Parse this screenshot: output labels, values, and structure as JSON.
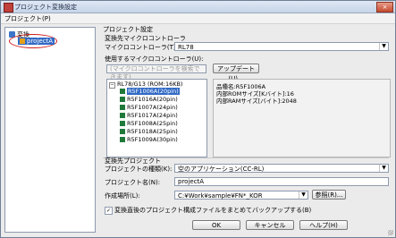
{
  "window": {
    "title": "プロジェクト変換設定",
    "close_glyph": "×"
  },
  "menu": {
    "project": "プロジェクト(P)"
  },
  "tree": {
    "root": "変換",
    "project": "projectA"
  },
  "settings": {
    "header": "プロジェクト設定",
    "mcu_group": "変換先マイクロコントローラ",
    "mcu_label": "マイクロコントローラ(T):",
    "mcu_value": "RL78",
    "use_label": "使用するマイクロコントローラ(U):",
    "search_placeholder": "(マイクロコントローラを検索できます)",
    "update_button": "アップデート(U)..."
  },
  "device_list": {
    "root_label": "RL78/G13 (ROM:16KB)",
    "items": [
      "R5F1006A(20pin)",
      "R5F1016A(20pin)",
      "R5F1007A(24pin)",
      "R5F1017A(24pin)",
      "R5F1008A(25pin)",
      "R5F1018A(25pin)",
      "R5F1009A(30pin)"
    ],
    "selected_index": 0
  },
  "device_info": {
    "name": "品種名:R5F1006A",
    "rom": "内部ROMサイズ[Kバイト]:16",
    "ram": "内部RAMサイズ[バイト]:2048"
  },
  "target": {
    "header": "変換先プロジェクト",
    "type_label": "プロジェクトの種類(K):",
    "type_value": "空のアプリケーション(CC-RL)",
    "name_label": "プロジェクト名(N):",
    "name_value": "projectA",
    "location_label": "作成場所(L):",
    "location_value": "C:¥Work¥sample¥FN*_KOR",
    "browse_button": "参照(R)...",
    "backup_label": "変換直後のプロジェクト構成ファイルをまとめてバックアップする(B)",
    "backup_checked": true
  },
  "buttons": {
    "ok": "OK",
    "cancel": "キャンセル",
    "help": "ヘルプ(H)"
  }
}
